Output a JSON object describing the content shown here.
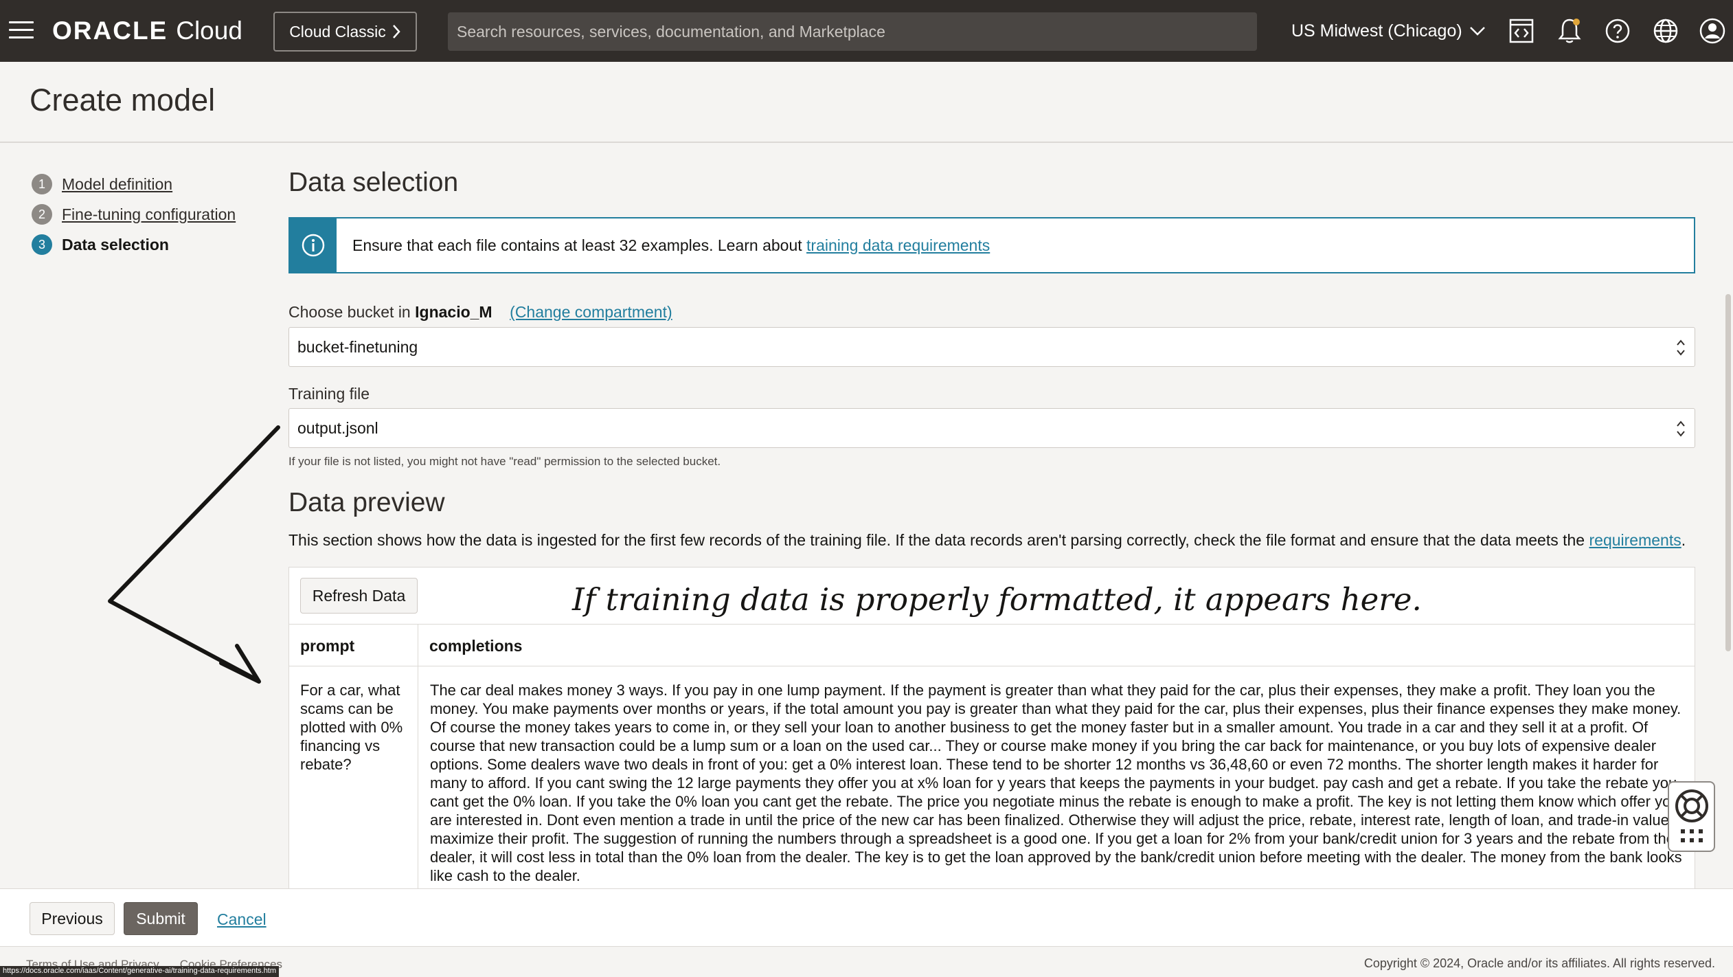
{
  "topbar": {
    "brand_oracle": "ORACLE",
    "brand_cloud": "Cloud",
    "classic_label": "Cloud Classic",
    "search_placeholder": "Search resources, services, documentation, and Marketplace",
    "region": "US Midwest (Chicago)",
    "icons": [
      "menu-icon",
      "code-editor-icon",
      "bell-icon",
      "help-icon",
      "globe-icon",
      "profile-icon"
    ]
  },
  "page": {
    "title": "Create model"
  },
  "steps": [
    {
      "num": "1",
      "label": "Model definition"
    },
    {
      "num": "2",
      "label": "Fine-tuning configuration"
    },
    {
      "num": "3",
      "label": "Data selection"
    }
  ],
  "data_selection": {
    "title": "Data selection",
    "info_text": "Ensure that each file contains at least 32 examples. Learn about",
    "info_link": "training data requirements",
    "bucket_label_prefix": "Choose bucket in",
    "compartment": "Ignacio_M",
    "change_compartment": "(Change compartment)",
    "bucket_value": "bucket-finetuning",
    "training_file_label": "Training file",
    "training_file_value": "output.jsonl",
    "hint": "If your file is not listed, you might not have \"read\" permission to the selected bucket."
  },
  "data_preview": {
    "title": "Data preview",
    "description": "This section shows how the data is ingested for the first few records of the training file. If the data records aren't parsing correctly, check the file format and ensure that the data meets the",
    "requirements_link": "requirements",
    "refresh_label": "Refresh Data",
    "annotation": "If training data is properly formatted, it appears here.",
    "columns": [
      "prompt",
      "completions"
    ],
    "rows": [
      {
        "prompt": "For a car, what scams can be plotted with 0% financing vs rebate?",
        "completion": "The car deal makes money 3 ways. If you pay in one lump payment. If the payment is greater than what they paid for the car, plus their expenses, they make a profit. They loan you the money. You make payments over months or years, if the total amount you pay is greater than what they paid for the car, plus their expenses, plus their finance expenses they make money. Of course the money takes years to come in, or they sell your loan to another business to get the money faster but in a smaller amount. You trade in a car and they sell it at a profit. Of course that new transaction could be a lump sum or a loan on the used car... They or course make money if you bring the car back for maintenance, or you buy lots of expensive dealer options. Some dealers wave two deals in front of you: get a 0% interest loan. These tend to be shorter 12 months vs 36,48,60 or even 72 months. The shorter length makes it harder for many to afford. If you cant swing the 12 large payments they offer you at x% loan for y years that keeps the payments in your budget. pay cash and get a rebate. If you take the rebate you cant get the 0% loan. If you take the 0% loan you cant get the rebate. The price you negotiate minus the rebate is enough to make a profit. The key is not letting them know which offer you are interested in. Dont even mention a trade in until the price of the new car has been finalized. Otherwise they will adjust the price, rebate, interest rate, length of loan, and trade-in value to maximize their profit. The suggestion of running the numbers through a spreadsheet is a good one. If you get a loan for 2% from your bank/credit union for 3 years and the rebate from the dealer, it will cost less in total than the 0% loan from the dealer. The key is to get the loan approved by the bank/credit union before meeting with the dealer. The money from the bank looks like cash to the dealer."
      }
    ]
  },
  "actions": {
    "previous": "Previous",
    "submit": "Submit",
    "cancel": "Cancel"
  },
  "footer": {
    "links": [
      "Terms of Use and Privacy",
      "Cookie Preferences"
    ],
    "copyright": "Copyright © 2024, Oracle and/or its affiliates. All rights reserved.",
    "status_url": "https://docs.oracle.com/iaas/Content/generative-ai/training-data-requirements.htm"
  },
  "colors": {
    "topbar": "#312d2a",
    "accent": "#227e9e",
    "background": "#f5f4f2"
  }
}
